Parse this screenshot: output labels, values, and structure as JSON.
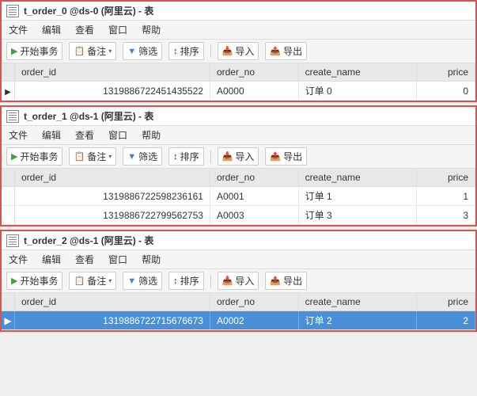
{
  "windows": [
    {
      "id": "window-0",
      "title": "t_order_0 @ds-0 (阿里云) - 表",
      "menu": [
        "文件",
        "编辑",
        "查看",
        "窗口",
        "帮助"
      ],
      "toolbar": {
        "btn_transaction": "开始事务",
        "btn_backup": "备注",
        "btn_filter": "筛选",
        "btn_sort": "排序",
        "btn_import": "导入",
        "btn_export": "导出"
      },
      "columns": [
        "order_id",
        "order_no",
        "create_name",
        "price"
      ],
      "rows": [
        {
          "indicator": "▶",
          "selected": false,
          "order_id": "1319886722451435522",
          "order_no": "A0000",
          "create_name": "订单 0",
          "price": "0"
        }
      ]
    },
    {
      "id": "window-1",
      "title": "t_order_1 @ds-1 (阿里云) - 表",
      "menu": [
        "文件",
        "编辑",
        "查看",
        "窗口",
        "帮助"
      ],
      "toolbar": {
        "btn_transaction": "开始事务",
        "btn_backup": "备注",
        "btn_filter": "筛选",
        "btn_sort": "排序",
        "btn_import": "导入",
        "btn_export": "导出"
      },
      "columns": [
        "order_id",
        "order_no",
        "create_name",
        "price"
      ],
      "rows": [
        {
          "indicator": " ",
          "selected": false,
          "order_id": "1319886722598236161",
          "order_no": "A0001",
          "create_name": "订单 1",
          "price": "1"
        },
        {
          "indicator": " ",
          "selected": false,
          "order_id": "1319886722799562753",
          "order_no": "A0003",
          "create_name": "订单 3",
          "price": "3"
        }
      ]
    },
    {
      "id": "window-2",
      "title": "t_order_2 @ds-1 (阿里云) - 表",
      "menu": [
        "文件",
        "编辑",
        "查看",
        "窗口",
        "帮助"
      ],
      "toolbar": {
        "btn_transaction": "开始事务",
        "btn_backup": "备注",
        "btn_filter": "筛选",
        "btn_sort": "排序",
        "btn_import": "导入",
        "btn_export": "导出"
      },
      "columns": [
        "order_id",
        "order_no",
        "create_name",
        "price"
      ],
      "rows": [
        {
          "indicator": "▶",
          "selected": true,
          "order_id": "1319886722715676673",
          "order_no": "A0002",
          "create_name": "订单 2",
          "price": "2"
        }
      ]
    }
  ],
  "icons": {
    "transaction": "▶",
    "backup": "📋",
    "filter": "▼",
    "sort": "↕",
    "import": "📥",
    "export": "📤",
    "dropdown": "▾"
  }
}
